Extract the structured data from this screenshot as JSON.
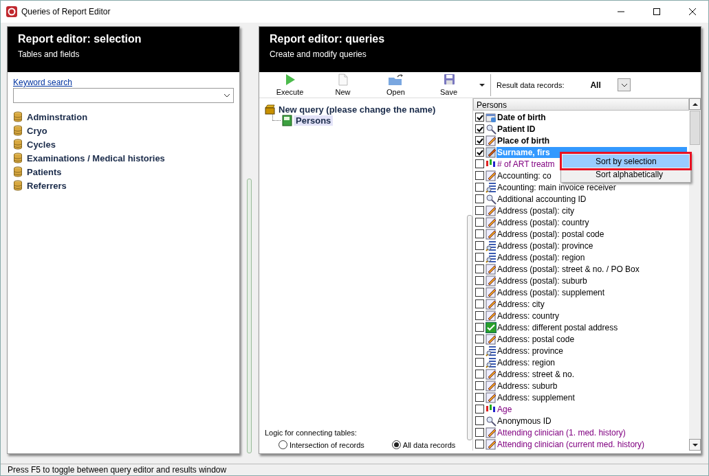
{
  "window": {
    "title": "Queries of Report Editor"
  },
  "selection_panel": {
    "title": "Report editor: selection",
    "subtitle": "Tables and fields",
    "search": {
      "label": "Keyword search"
    },
    "tables": [
      {
        "label": "Adminstration"
      },
      {
        "label": "Cryo"
      },
      {
        "label": "Cycles"
      },
      {
        "label": "Examinations / Medical histories"
      },
      {
        "label": "Patients"
      },
      {
        "label": "Referrers"
      }
    ]
  },
  "queries_panel": {
    "title": "Report editor: queries",
    "subtitle": "Create and modify queries",
    "toolbar": [
      {
        "label": "Execute",
        "kind": "play"
      },
      {
        "label": "New",
        "kind": "page"
      },
      {
        "label": "Open",
        "kind": "folder"
      },
      {
        "label": "Save",
        "kind": "disk"
      }
    ],
    "result_records": {
      "label": "Result data records:",
      "value": "All"
    },
    "query_tree": {
      "label": "New query (please change the name)",
      "children": [
        {
          "label": "Persons",
          "selected": true
        }
      ]
    },
    "logic": {
      "label": "Logic for connecting tables:",
      "options": [
        {
          "label": "Intersection of records",
          "selected": false
        },
        {
          "label": "All data records",
          "selected": true
        }
      ]
    },
    "fields": {
      "header": "Persons",
      "items": [
        {
          "label": "Date of birth",
          "kind": "date",
          "checked": true,
          "selected": false
        },
        {
          "label": "Patient ID",
          "kind": "key",
          "checked": true,
          "selected": false
        },
        {
          "label": "Place of birth",
          "kind": "text",
          "checked": true,
          "selected": false
        },
        {
          "label": "Surname, firs",
          "kind": "multi",
          "checked": true,
          "selected": true
        },
        {
          "label": "# of ART treatm",
          "kind": "number",
          "checked": false,
          "selected": false,
          "color": "#800080"
        },
        {
          "label": "Accounting: co",
          "kind": "text",
          "checked": false,
          "selected": false
        },
        {
          "label": "Acounting: main invoice receiver",
          "kind": "lookup",
          "checked": false,
          "selected": false
        },
        {
          "label": "Additional accounting ID",
          "kind": "key",
          "checked": false,
          "selected": false
        },
        {
          "label": "Address (postal): city",
          "kind": "text",
          "checked": false,
          "selected": false
        },
        {
          "label": "Address (postal): country",
          "kind": "text",
          "checked": false,
          "selected": false
        },
        {
          "label": "Address (postal): postal code",
          "kind": "text",
          "checked": false,
          "selected": false
        },
        {
          "label": "Address (postal): province",
          "kind": "lookup",
          "checked": false,
          "selected": false
        },
        {
          "label": "Address (postal): region",
          "kind": "lookup",
          "checked": false,
          "selected": false
        },
        {
          "label": "Address (postal): street & no. / PO Box",
          "kind": "text",
          "checked": false,
          "selected": false
        },
        {
          "label": "Address (postal): suburb",
          "kind": "text",
          "checked": false,
          "selected": false
        },
        {
          "label": "Address (postal): supplement",
          "kind": "text",
          "checked": false,
          "selected": false
        },
        {
          "label": "Address: city",
          "kind": "text",
          "checked": false,
          "selected": false
        },
        {
          "label": "Address: country",
          "kind": "text",
          "checked": false,
          "selected": false
        },
        {
          "label": "Address: different postal address",
          "kind": "bool",
          "checked": false,
          "selected": false
        },
        {
          "label": "Address: postal code",
          "kind": "text",
          "checked": false,
          "selected": false
        },
        {
          "label": "Address: province",
          "kind": "lookup",
          "checked": false,
          "selected": false
        },
        {
          "label": "Address: region",
          "kind": "lookup",
          "checked": false,
          "selected": false
        },
        {
          "label": "Address: street & no.",
          "kind": "text",
          "checked": false,
          "selected": false
        },
        {
          "label": "Address: suburb",
          "kind": "text",
          "checked": false,
          "selected": false
        },
        {
          "label": "Address: supplement",
          "kind": "text",
          "checked": false,
          "selected": false
        },
        {
          "label": "Age",
          "kind": "number",
          "checked": false,
          "selected": false,
          "color": "#800080"
        },
        {
          "label": "Anonymous ID",
          "kind": "key",
          "checked": false,
          "selected": false
        },
        {
          "label": "Attending clinician (1. med. history)",
          "kind": "text",
          "checked": false,
          "selected": false,
          "color": "#800080"
        },
        {
          "label": "Attending clinician (current med. history)",
          "kind": "text",
          "checked": false,
          "selected": false,
          "color": "#800080"
        }
      ]
    },
    "context_menu": {
      "items": [
        {
          "label": "Sort by selection",
          "selected": true
        },
        {
          "label": "Sort alphabetically",
          "selected": false
        }
      ]
    }
  },
  "status_bar": {
    "text": "Press F5 to toggle between query editor and results window"
  }
}
